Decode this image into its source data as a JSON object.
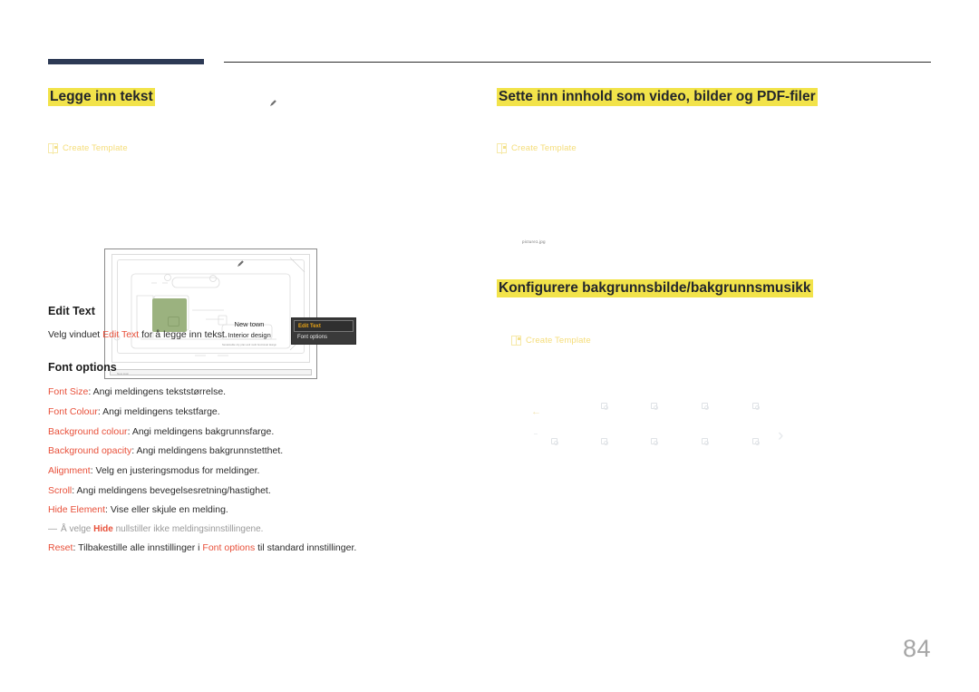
{
  "page": {
    "number": "84",
    "accent_color": "#e8503a",
    "highlight_color": "#f2e34a",
    "rule_color": "#2d3a55",
    "link_color": "#f5dd7a"
  },
  "left": {
    "heading": "Legge inn tekst",
    "create_template": {
      "label": "Create Template",
      "icon": "template-icon"
    },
    "illustration": {
      "screen_text_line1": "New town",
      "screen_text_line2": "Interior design",
      "screen_text_tiny": "Sustainable city plan and multi functional design",
      "foot_label": "New town",
      "context_menu": {
        "items": [
          {
            "label": "Edit Text",
            "selected": true
          },
          {
            "label": "Font options",
            "selected": false
          }
        ]
      },
      "pen_icon": "pen-icon"
    },
    "section_edit_text": {
      "heading": "Edit Text",
      "para_prefix": "Velg vinduet ",
      "para_accent": "Edit Text",
      "para_suffix": " for å legge inn tekst."
    },
    "section_font_options": {
      "heading": "Font options",
      "items": [
        {
          "term": "Font Size",
          "desc": ": Angi meldingens tekststørrelse."
        },
        {
          "term": "Font Colour",
          "desc": ": Angi meldingens tekstfarge."
        },
        {
          "term": "Background colour",
          "desc": ": Angi meldingens bakgrunnsfarge."
        },
        {
          "term": "Background opacity",
          "desc": ": Angi meldingens bakgrunnstetthet."
        },
        {
          "term": "Alignment",
          "desc": ": Velg en justeringsmodus for meldinger."
        },
        {
          "term": "Scroll",
          "desc": ": Angi meldingens bevegelsesretning/hastighet."
        },
        {
          "term": "Hide Element",
          "desc": ": Vise eller skjule en melding."
        }
      ],
      "note": {
        "dash": "—",
        "prefix": "Å velge ",
        "highlight": "Hide",
        "suffix": " nullstiller ikke meldingsinnstillingene."
      },
      "reset": {
        "term": "Reset",
        "mid": ": Tilbakestille alle innstillinger i ",
        "accent": "Font options",
        "suffix": " til standard innstillinger."
      }
    }
  },
  "right": {
    "heading_media": "Sette inn innhold som video, bilder og PDF-filer",
    "create_template_media": {
      "label": "Create Template",
      "icon": "template-icon"
    },
    "media_image_label": "picture1.jpg",
    "heading_background": "Konfigurere bakgrunnsbilde/bakgrunnsmusikk",
    "create_template_background": {
      "label": "Create Template",
      "icon": "template-icon"
    },
    "gallery": {
      "back_icon": "back-arrow-icon",
      "next_icon": "chevron-right-icon",
      "dash_icon": "dash-icon",
      "thumbnail_count": 10
    }
  }
}
